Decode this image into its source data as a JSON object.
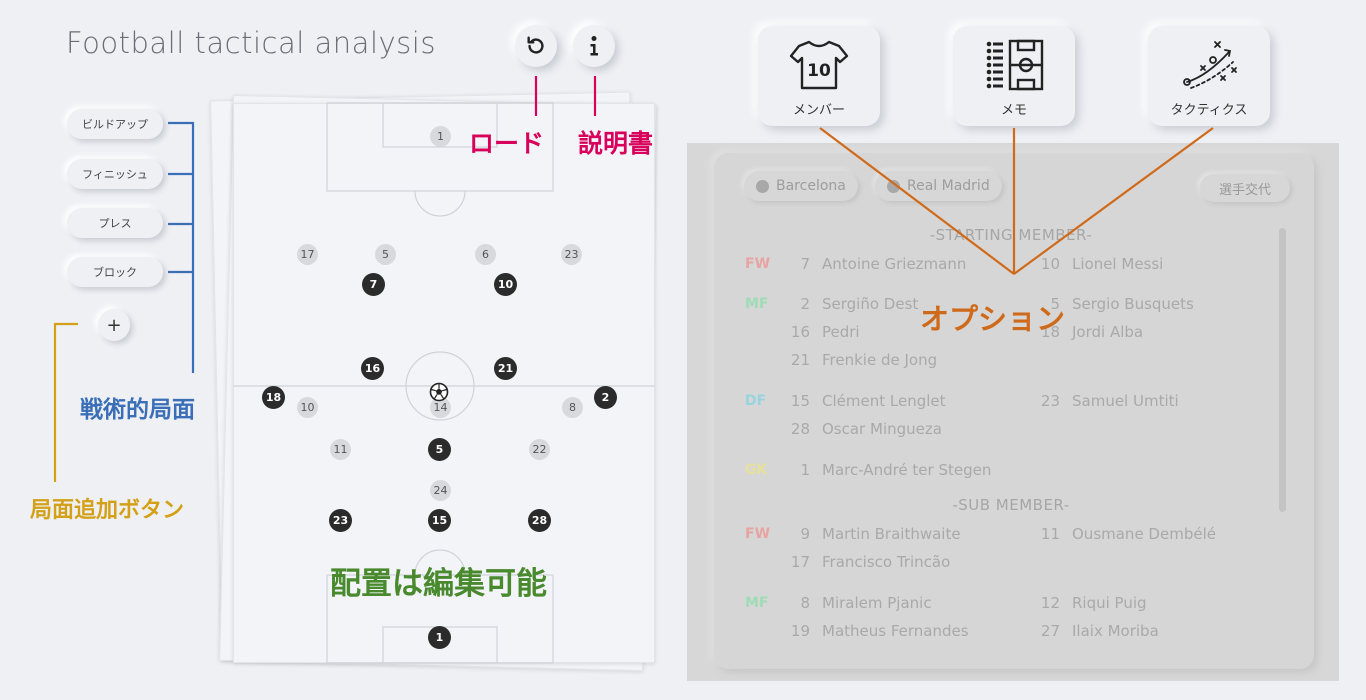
{
  "header": {
    "title": "Football tactical analysis"
  },
  "phases": [
    {
      "label": "ビルドアップ"
    },
    {
      "label": "フィニッシュ"
    },
    {
      "label": "プレス"
    },
    {
      "label": "ブロック"
    }
  ],
  "add_phase_label": "+",
  "options": [
    {
      "label": "メンバー",
      "icon": "jersey-icon",
      "jersey_number": "10"
    },
    {
      "label": "メモ",
      "icon": "memo-icon"
    },
    {
      "label": "タクティクス",
      "icon": "tactics-icon"
    }
  ],
  "pitch": {
    "light_players": [
      "1",
      "17",
      "5",
      "6",
      "23",
      "10",
      "14",
      "8",
      "11",
      "22",
      "24"
    ],
    "dark_players": [
      "7",
      "10",
      "16",
      "21",
      "18",
      "2",
      "5",
      "23",
      "15",
      "28",
      "1"
    ]
  },
  "panel": {
    "teams": [
      {
        "name": "Barcelona"
      },
      {
        "name": "Real Madrid"
      }
    ],
    "substitution_label": "選手交代",
    "starting_title": "-STARTING MEMBER-",
    "sub_title": "-SUB MEMBER-",
    "position_colors": {
      "FW": "#e8a3a3",
      "MF": "#9fdcb6",
      "DF": "#98d4e0",
      "GK": "#e6e19a"
    },
    "starting": [
      {
        "pos": "FW",
        "left": [
          {
            "num": "7",
            "name": "Antoine Griezmann"
          }
        ],
        "right": [
          {
            "num": "10",
            "name": "Lionel Messi"
          }
        ]
      },
      {
        "pos": "MF",
        "left": [
          {
            "num": "2",
            "name": "Sergiño Dest"
          },
          {
            "num": "16",
            "name": "Pedri"
          },
          {
            "num": "21",
            "name": "Frenkie de Jong"
          }
        ],
        "right": [
          {
            "num": "5",
            "name": "Sergio Busquets"
          },
          {
            "num": "18",
            "name": "Jordi Alba"
          }
        ]
      },
      {
        "pos": "DF",
        "left": [
          {
            "num": "15",
            "name": "Clément Lenglet"
          },
          {
            "num": "28",
            "name": "Oscar Mingueza"
          }
        ],
        "right": [
          {
            "num": "23",
            "name": "Samuel Umtiti"
          }
        ]
      },
      {
        "pos": "GK",
        "left": [
          {
            "num": "1",
            "name": "Marc-André ter Stegen"
          }
        ],
        "right": []
      }
    ],
    "subs": [
      {
        "pos": "FW",
        "left": [
          {
            "num": "9",
            "name": "Martin Braithwaite"
          },
          {
            "num": "17",
            "name": "Francisco Trincão"
          }
        ],
        "right": [
          {
            "num": "11",
            "name": "Ousmane Dembélé"
          }
        ]
      },
      {
        "pos": "MF",
        "left": [
          {
            "num": "8",
            "name": "Miralem Pjanic"
          },
          {
            "num": "19",
            "name": "Matheus Fernandes"
          }
        ],
        "right": [
          {
            "num": "12",
            "name": "Riqui Puig"
          },
          {
            "num": "27",
            "name": "Ilaix Moriba"
          }
        ]
      }
    ]
  },
  "annotations": {
    "load": "ロード",
    "manual": "説明書",
    "phases": "戦術的局面",
    "add_phase": "局面追加ボタン",
    "editable": "配置は編集可能",
    "options": "オプション",
    "colors": {
      "load": "#d9005b",
      "manual": "#d9005b",
      "phases": "#3a6fb8",
      "add_phase": "#d4a017",
      "editable": "#4a8a2e",
      "options": "#cf6a1a"
    }
  }
}
